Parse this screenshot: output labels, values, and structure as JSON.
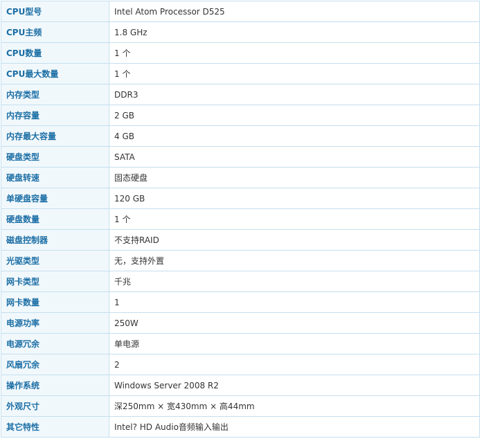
{
  "specs": [
    {
      "key": "CPU型号",
      "value": "Intel Atom Processor D525"
    },
    {
      "key": "CPU主频",
      "value": "1.8  GHz"
    },
    {
      "key": "CPU数量",
      "value": "1  个"
    },
    {
      "key": "CPU最大数量",
      "value": "1  个"
    },
    {
      "key": "内存类型",
      "value": "DDR3"
    },
    {
      "key": "内存容量",
      "value": "2  GB"
    },
    {
      "key": "内存最大容量",
      "value": "4  GB"
    },
    {
      "key": "硬盘类型",
      "value": "SATA"
    },
    {
      "key": "硬盘转速",
      "value": "固态硬盘"
    },
    {
      "key": "单硬盘容量",
      "value": "120  GB"
    },
    {
      "key": "硬盘数量",
      "value": "1  个"
    },
    {
      "key": "磁盘控制器",
      "value": "不支持RAID"
    },
    {
      "key": "光驱类型",
      "value": "无，支持外置"
    },
    {
      "key": "网卡类型",
      "value": "千兆"
    },
    {
      "key": "网卡数量",
      "value": "1"
    },
    {
      "key": "电源功率",
      "value": "250W"
    },
    {
      "key": "电源冗余",
      "value": "单电源"
    },
    {
      "key": "风扇冗余",
      "value": "2"
    },
    {
      "key": "操作系统",
      "value": "Windows Server 2008 R2"
    },
    {
      "key": "外观尺寸",
      "value": "深250mm × 宽430mm × 高44mm"
    },
    {
      "key": "其它特性",
      "value": "Intel? HD Audio音频输入输出"
    }
  ],
  "colors": {
    "key_text": "#1d6fa5",
    "key_background": "#f1f8fc",
    "border": "#c5dfee",
    "value_text": "#333333"
  }
}
